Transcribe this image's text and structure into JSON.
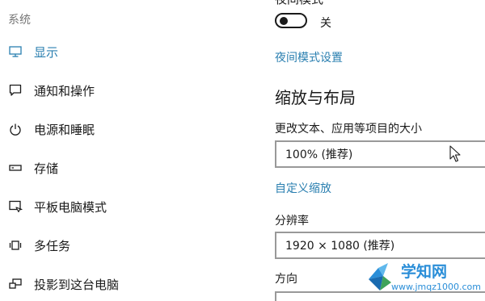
{
  "sidebar": {
    "header": "系统",
    "items": [
      {
        "label": "显示",
        "icon": "monitor-icon",
        "active": true
      },
      {
        "label": "通知和操作",
        "icon": "notification-icon",
        "active": false
      },
      {
        "label": "电源和睡眠",
        "icon": "power-icon",
        "active": false
      },
      {
        "label": "存储",
        "icon": "storage-icon",
        "active": false
      },
      {
        "label": "平板电脑模式",
        "icon": "tablet-mode-icon",
        "active": false
      },
      {
        "label": "多任务",
        "icon": "multitask-icon",
        "active": false
      },
      {
        "label": "投影到这台电脑",
        "icon": "projection-icon",
        "active": false
      }
    ]
  },
  "main": {
    "night_light": {
      "header": "夜间模式",
      "toggle_state": "关",
      "settings_link": "夜间模式设置"
    },
    "scale_layout": {
      "title": "缩放与布局",
      "scale_label": "更改文本、应用等项目的大小",
      "scale_value": "100% (推荐)",
      "custom_scaling_link": "自定义缩放",
      "resolution_label": "分辨率",
      "resolution_value": "1920 × 1080 (推荐)",
      "orientation_label": "方向"
    }
  },
  "watermark": {
    "text": "学知网",
    "url": "www.jmqz1000.com"
  },
  "colors": {
    "accent": "#2a7fb0",
    "watermark": "#2a8ed8"
  }
}
